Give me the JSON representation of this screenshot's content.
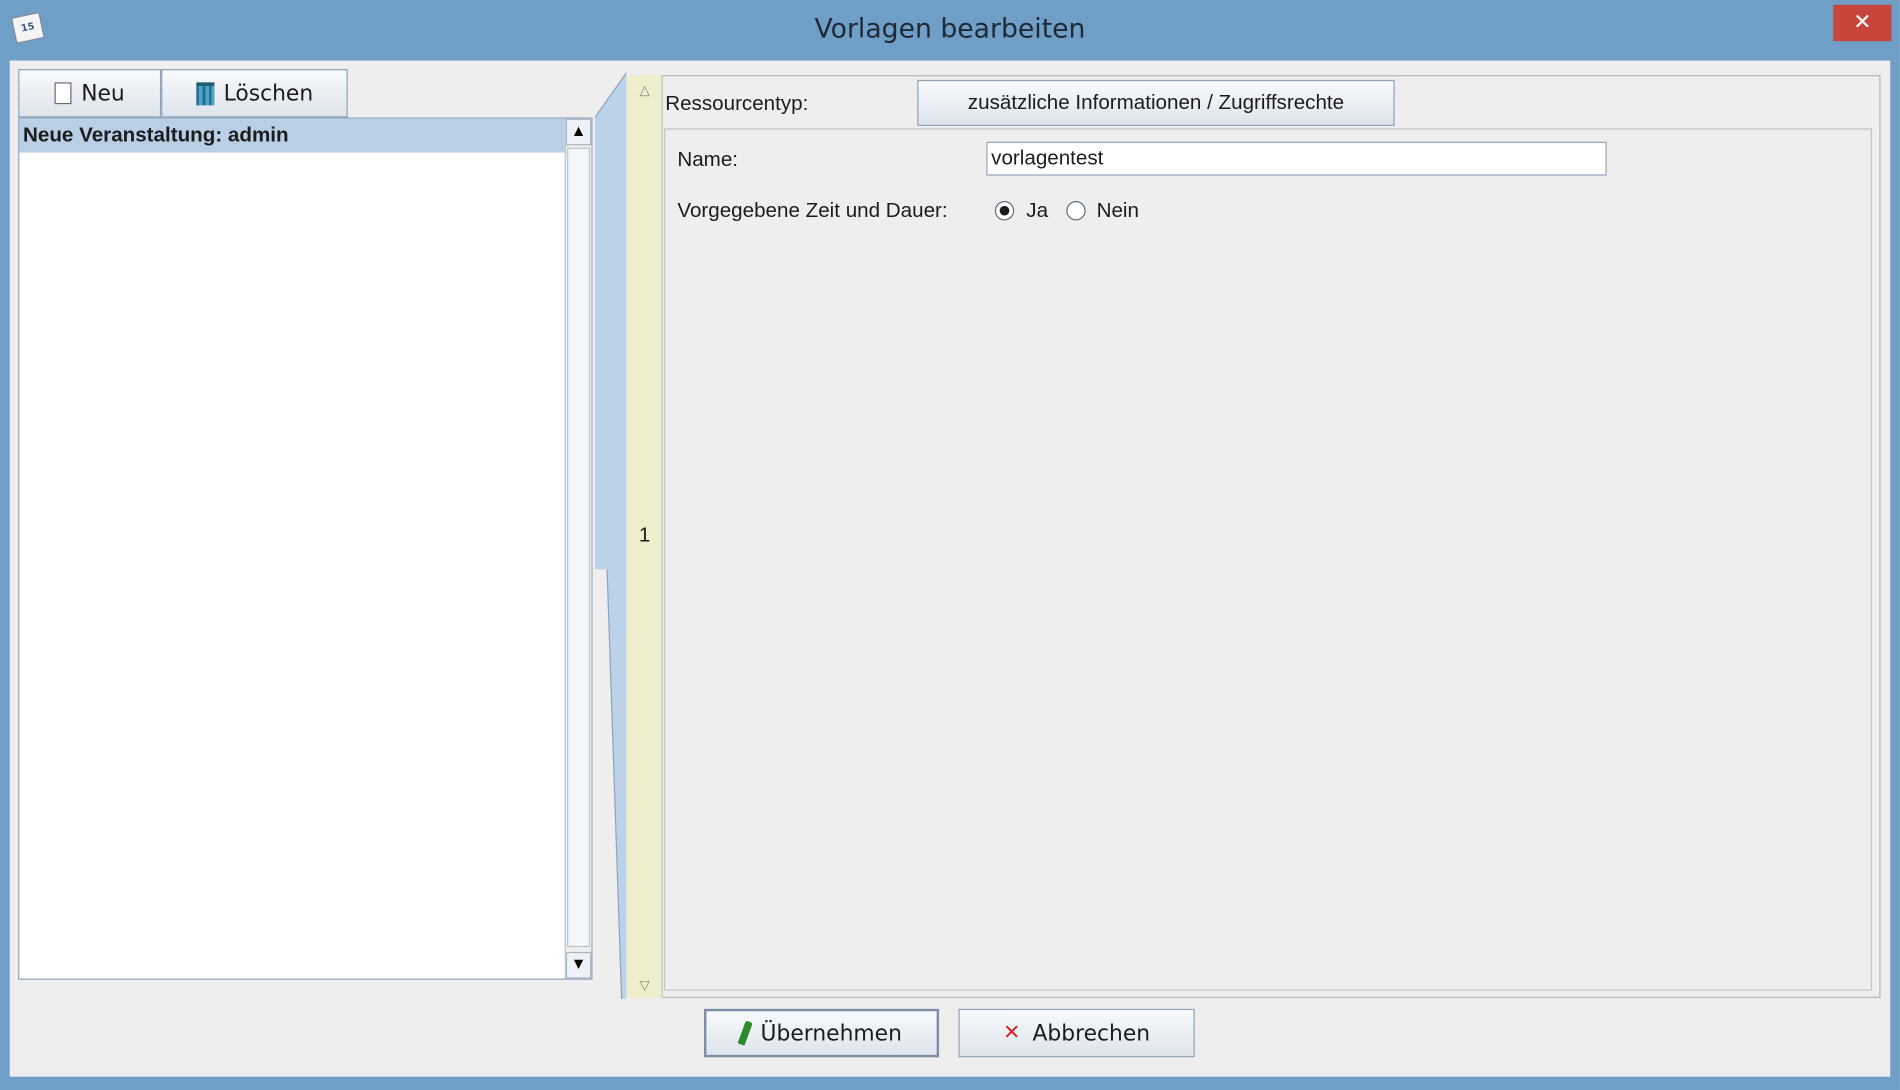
{
  "window": {
    "title": "Vorlagen bearbeiten",
    "close_glyph": "✕",
    "app_icon_text": "15"
  },
  "toolbar": {
    "new_label": "Neu",
    "delete_label": "Löschen"
  },
  "template_list": {
    "items": [
      {
        "label": "Neue Veranstaltung: admin",
        "selected": true
      }
    ]
  },
  "side_strip": {
    "page_number": "1"
  },
  "form": {
    "resource_type_label": "Ressourcentyp:",
    "extra_info_button": "zusätzliche Informationen / Zugriffsrechte",
    "name_label": "Name:",
    "name_value": "vorlagentest",
    "preset_time_label": "Vorgegebene Zeit und Dauer:",
    "preset_time_options": [
      {
        "label": "Ja",
        "checked": true
      },
      {
        "label": "Nein",
        "checked": false
      }
    ]
  },
  "actions": {
    "apply_label": "Übernehmen",
    "cancel_label": "Abbrechen"
  },
  "icons": {
    "new": "document-icon",
    "delete": "trash-icon",
    "apply": "pen-icon",
    "cancel": "x-icon"
  },
  "colors": {
    "title_bar": "#6f9fc7",
    "close_button": "#c7453b",
    "selection": "#b8cfe6",
    "side_strip": "#eeedcc"
  }
}
